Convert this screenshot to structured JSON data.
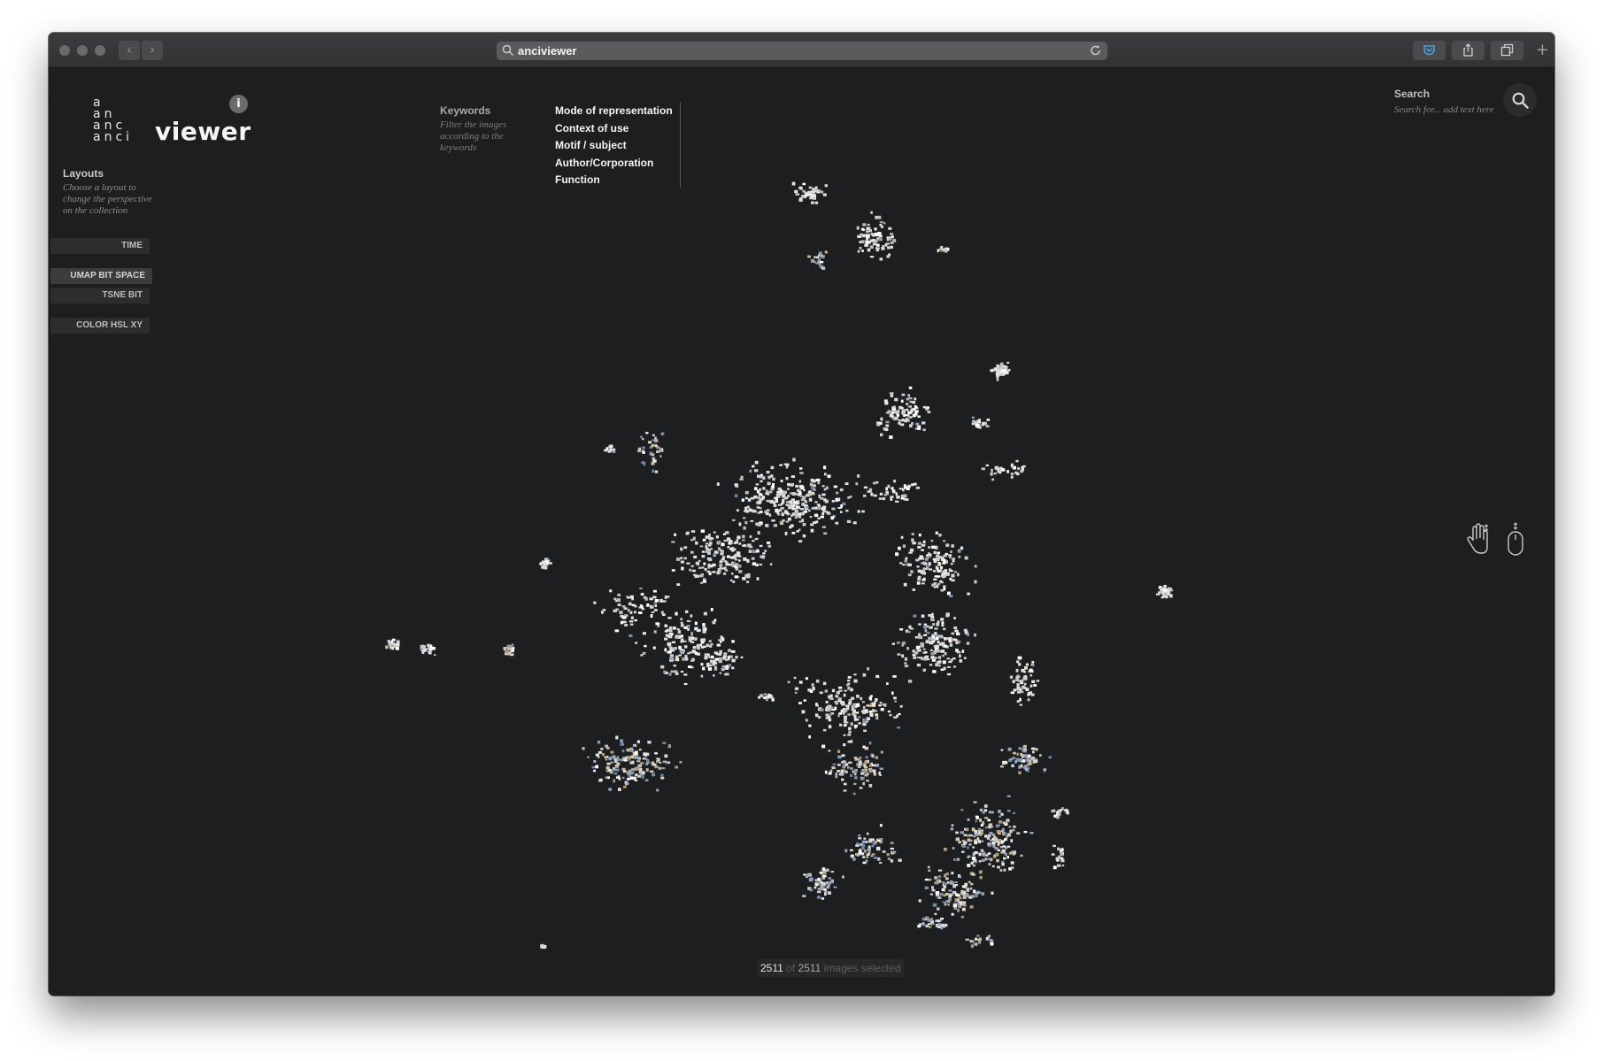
{
  "browser": {
    "url": "anciviewer",
    "colors": {
      "chrome": "#3a3a3c",
      "page_bg": "#1d1e20",
      "accent": "#4aa3df"
    },
    "icons": [
      "close-dot",
      "minimize-dot",
      "zoom-dot",
      "back-icon",
      "forward-icon",
      "search-icon",
      "reload-icon",
      "pocket-icon",
      "share-icon",
      "tabs-icon",
      "new-tab-icon"
    ]
  },
  "app": {
    "logo_stack": [
      "a",
      "an",
      "anc",
      "anci"
    ],
    "logo_word": "viewer",
    "info_label": "i"
  },
  "layouts": {
    "title": "Layouts",
    "description": "Choose a layout to change the perspective on the collection",
    "buttons": [
      {
        "label": "TIME",
        "active": false
      },
      {
        "label": "UMAP BIT SPACE",
        "active": true
      },
      {
        "label": "TSNE BIT",
        "active": false
      },
      {
        "label": "COLOR HSL XY",
        "active": false
      }
    ]
  },
  "keywords": {
    "title": "Keywords",
    "description": "Filter the images according to the keywords",
    "items": [
      "Mode of representation",
      "Context of use",
      "Motif / subject",
      "Author/Corporation",
      "Function"
    ]
  },
  "search": {
    "title": "Search",
    "placeholder": "Search for... add text here"
  },
  "navigation_hints": [
    "hand-gesture-icon",
    "mouse-scroll-icon"
  ],
  "status": {
    "selected": "2511",
    "of": "of",
    "total": "2511",
    "suffix": "images selected"
  }
}
